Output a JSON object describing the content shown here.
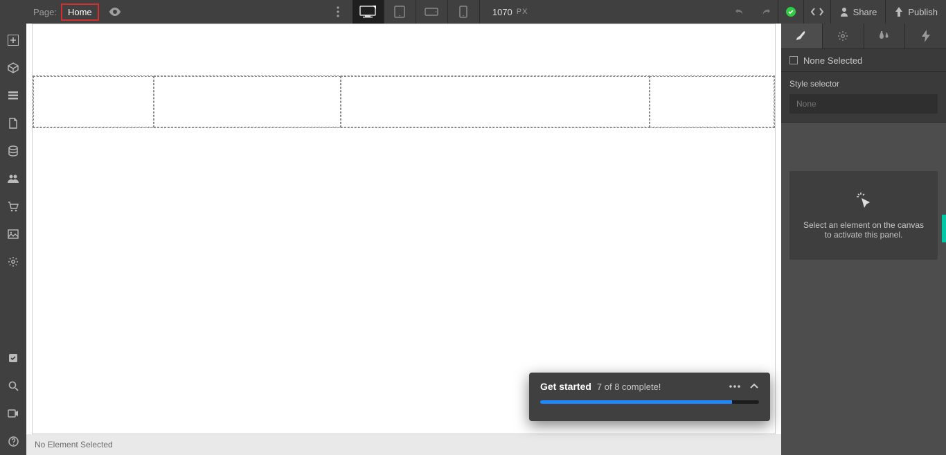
{
  "topbar": {
    "page_label": "Page:",
    "page_name": "Home",
    "width_value": "1070",
    "width_unit": "PX",
    "share_label": "Share",
    "publish_label": "Publish"
  },
  "statusbar": {
    "text": "No Element Selected"
  },
  "right_panel": {
    "none_selected": "None Selected",
    "style_selector_label": "Style selector",
    "selector_placeholder": "None",
    "empty_hint": "Select an element on the canvas to activate this panel."
  },
  "onboarding": {
    "title": "Get started",
    "subtitle": "7 of 8 complete!",
    "progress_completed": 7,
    "progress_total": 8
  }
}
